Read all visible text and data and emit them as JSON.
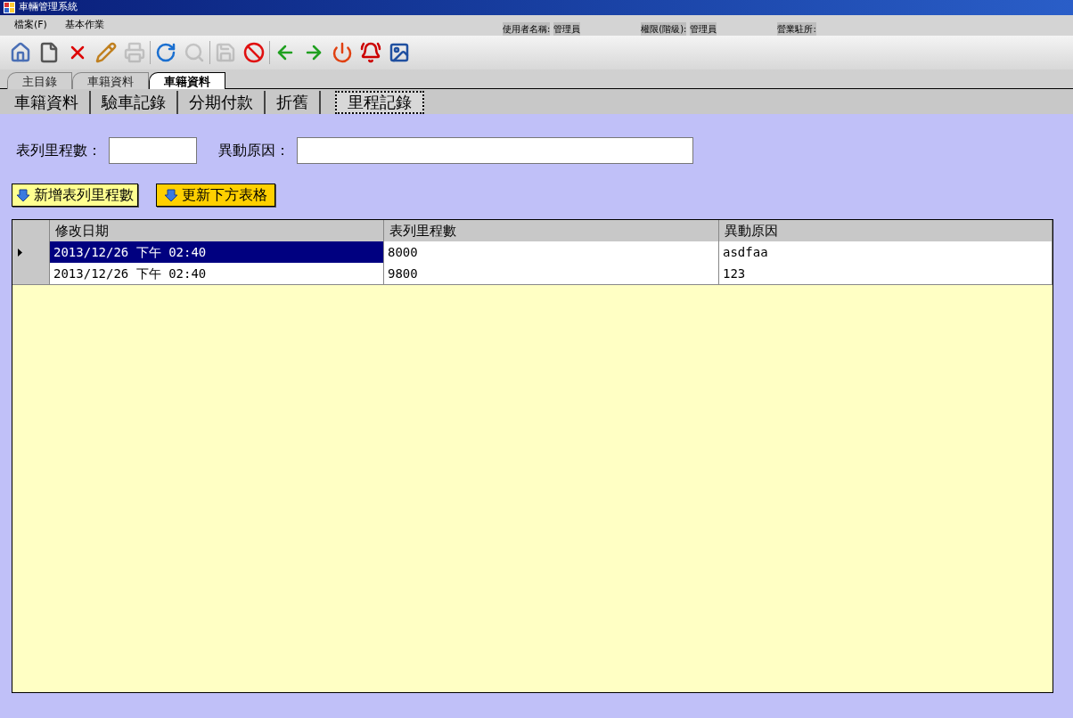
{
  "window": {
    "title": "車輛管理系統"
  },
  "menu": [
    "檔案(F)",
    "基本作業"
  ],
  "user_info": [
    {
      "label": "使用者名稱:",
      "value": "管理員"
    },
    {
      "label": "權限(階級):",
      "value": "管理員"
    },
    {
      "label": "營業駐所:"
    }
  ],
  "toolbar": [
    {
      "disabled": false
    },
    {
      "disabled": false
    },
    {
      "disabled": false
    },
    {
      "disabled": false
    },
    {
      "disabled": true
    },
    {
      "disabled": false
    },
    {
      "disabled": true
    },
    {
      "disabled": true
    },
    {
      "disabled": false
    },
    {
      "disabled": false
    },
    {
      "disabled": false
    },
    {
      "disabled": false
    },
    {
      "disabled": false
    },
    {
      "disabled": false
    }
  ],
  "tabs": [
    {
      "label": "主目錄",
      "selected": false
    },
    {
      "label": "車籍資料",
      "selected": false
    },
    {
      "label": "車籍資料",
      "selected": true
    }
  ],
  "subtabs": [
    {
      "label": "車籍資料",
      "selected": false
    },
    {
      "label": "驗車記錄",
      "selected": false
    },
    {
      "label": "分期付款",
      "selected": false
    },
    {
      "label": "折舊",
      "selected": false
    },
    {
      "label": "里程記錄",
      "selected": true
    }
  ],
  "form": {
    "fields": [
      {
        "label": "表列里程數："
      },
      {
        "label": "異動原因："
      }
    ]
  },
  "buttons": [
    "新增表列里程數",
    "更新下方表格"
  ],
  "table": {
    "columns": [
      "修改日期",
      "表列里程數",
      "異動原因"
    ],
    "rows": [
      {
        "selected": true,
        "cells": [
          "2013/12/26 下午 02:40",
          "8000",
          "asdfaa"
        ]
      },
      {
        "selected": false,
        "cells": [
          "2013/12/26 下午 02:40",
          "9800",
          "123"
        ]
      }
    ]
  }
}
